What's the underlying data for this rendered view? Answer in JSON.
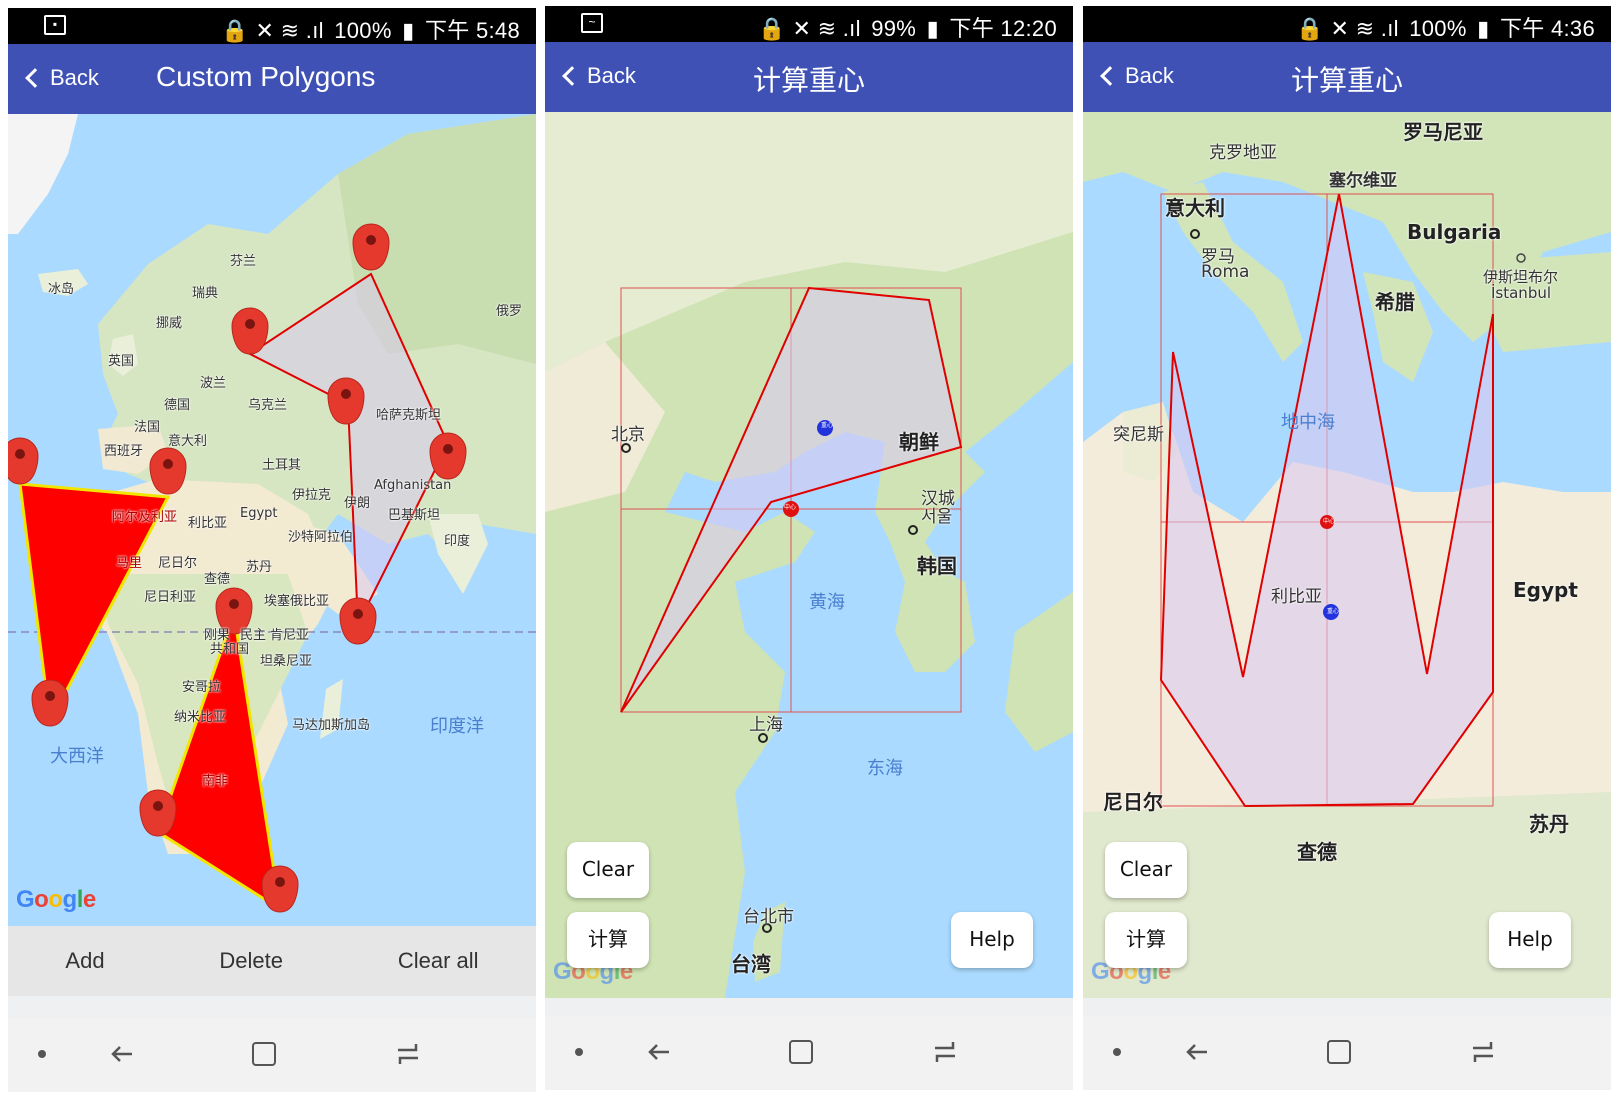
{
  "status_bar": [
    {
      "battery": "100%",
      "time": "下午 5:48"
    },
    {
      "battery": "99%",
      "time": "下午 12:20"
    },
    {
      "battery": "100%",
      "time": "下午 4:36"
    }
  ],
  "screens": [
    {
      "back_label": "Back",
      "title": "Custom Polygons",
      "actions": [
        "Add",
        "Delete",
        "Clear all"
      ],
      "map_labels": {
        "iceland": "冰岛",
        "finland": "芬兰",
        "sweden": "瑞典",
        "norway": "挪威",
        "russia": "俄罗",
        "uk": "英国",
        "poland": "波兰",
        "germany": "德国",
        "ukraine": "乌克兰",
        "france": "法国",
        "italy": "意大利",
        "kazakhstan": "哈萨克斯坦",
        "spain": "西班牙",
        "turkey": "土耳其",
        "iraq": "伊拉克",
        "iran": "伊朗",
        "afghanistan": "Afghanistan",
        "pakistan": "巴基斯坦",
        "algeria": "阿尔及利亚",
        "libya": "利比亚",
        "egypt": "Egypt",
        "saudi": "沙特阿拉伯",
        "india": "印度",
        "mali": "马里",
        "niger": "尼日尔",
        "sudan": "苏丹",
        "chad": "查德",
        "nigeria": "尼日利亚",
        "ethiopia": "埃塞俄比亚",
        "congo1": "刚果",
        "congo_dem": "民主",
        "congo2": "共和国",
        "kenya": "肯尼亚",
        "tanzania": "坦桑尼亚",
        "angola": "安哥拉",
        "namibia": "纳米比亚",
        "madagascar": "马达加斯加岛",
        "south_africa": "南非",
        "atlantic": "大西洋",
        "indian_ocean": "印度洋"
      }
    },
    {
      "back_label": "Back",
      "title": "计算重心",
      "buttons": {
        "clear": "Clear",
        "compute": "计算",
        "help": "Help"
      },
      "map_labels": {
        "beijing": "北京",
        "north_korea": "朝鲜",
        "seoul1": "汉城",
        "seoul2": "서울",
        "south_korea": "韩国",
        "yellow_sea": "黄海",
        "shanghai": "上海",
        "east_sea": "东海",
        "taipei": "台北市",
        "taiwan": "台湾"
      },
      "markers": {
        "centroid": "中心",
        "center": "重心"
      }
    },
    {
      "back_label": "Back",
      "title": "计算重心",
      "buttons": {
        "clear": "Clear",
        "compute": "计算",
        "help": "Help"
      },
      "map_labels": {
        "croatia": "克罗地亚",
        "romania": "罗马尼亚",
        "serbia": "塞尔维亚",
        "italy": "意大利",
        "bulgaria": "Bulgaria",
        "rome1": "罗马",
        "rome2": "Roma",
        "istanbul1": "伊斯坦布尔",
        "istanbul2": "İstanbul",
        "greece": "希腊",
        "tunisia": "突尼斯",
        "mediterranean": "地中海",
        "libya": "利比亚",
        "egypt": "Egypt",
        "niger": "尼日尔",
        "sudan": "苏丹",
        "chad": "查德"
      }
    }
  ],
  "google_logo": "Google",
  "colors": {
    "appbar": "#3f51b5",
    "water": "#aadaff",
    "land": "#e9efd9",
    "polygon_red": "#ff0000",
    "polygon_outline": "#ffee00",
    "centroid_fill": "#e8dcf5"
  }
}
